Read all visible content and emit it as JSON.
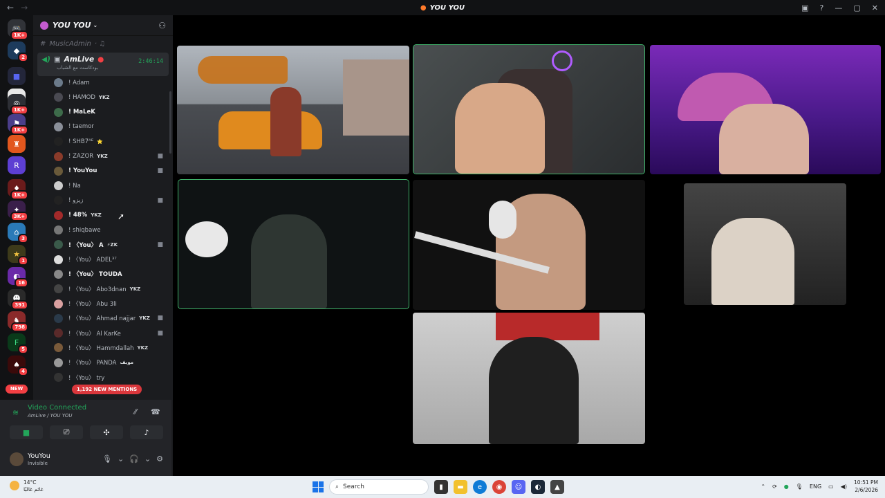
{
  "window": {
    "title": "YOU YOU"
  },
  "rail": {
    "servers": [
      {
        "badge": "1K+"
      },
      {
        "badge": "2"
      },
      {
        "badge": ""
      },
      {
        "badge": ""
      },
      {
        "badge": "1K+"
      },
      {
        "badge": "1K+"
      },
      {
        "badge": ""
      },
      {
        "badge": ""
      },
      {
        "badge": "1K+"
      },
      {
        "badge": "3K+"
      },
      {
        "badge": "3"
      },
      {
        "badge": "1"
      },
      {
        "badge": "16"
      },
      {
        "badge": "391"
      },
      {
        "badge": "798"
      },
      {
        "badge": "5"
      },
      {
        "badge": "4"
      }
    ],
    "new_label": "NEW"
  },
  "sidebar": {
    "guild_name": "YOU YOU",
    "prev_channel": "MusicAdmin",
    "voice_channel": {
      "name": "AmLive",
      "subtitle": "بودكاست مع الشباب",
      "time": "2:46:14"
    },
    "members": [
      {
        "name": "! Adam",
        "tag": "",
        "color": "#6b7a8a",
        "cam": false
      },
      {
        "name": "! HAMOD",
        "tag": "YKZ",
        "color": "#4a4a52",
        "cam": false
      },
      {
        "name": "! MaLeK",
        "tag": "",
        "color": "#3d6b4a",
        "cam": false,
        "bold": true
      },
      {
        "name": "! taemor",
        "tag": "",
        "color": "#8a8f99",
        "cam": false
      },
      {
        "name": "! SHB7ᴬᴱ",
        "tag": "⭐",
        "color": "#222",
        "cam": false
      },
      {
        "name": "! ZAZOR",
        "tag": "YKZ",
        "color": "#8a3b2a",
        "cam": true
      },
      {
        "name": "! YouYou",
        "tag": "",
        "color": "#6a5a3a",
        "cam": true,
        "bold": true
      },
      {
        "name": "! Na",
        "tag": "",
        "color": "#ccc",
        "cam": false
      },
      {
        "name": "! زيزو",
        "tag": "",
        "color": "#222",
        "cam": true
      },
      {
        "name": "! 48%",
        "tag": "YKZ",
        "color": "#a32a2a",
        "cam": false,
        "bold": true
      },
      {
        "name": "! shiqbawe",
        "tag": "",
        "color": "#777",
        "cam": false
      },
      {
        "name": "! 〈You〉 A",
        "tag": "⚡ZK",
        "color": "#3a5a4a",
        "cam": true,
        "bold": true
      },
      {
        "name": "! 〈You〉 ADEL³⁷",
        "tag": "",
        "color": "#ddd",
        "cam": false
      },
      {
        "name": "! 〈You〉 TOUDA",
        "tag": "",
        "color": "#888",
        "cam": false,
        "bold": true
      },
      {
        "name": "! 〈You〉 Abo3dnan",
        "tag": "YKZ",
        "color": "#444",
        "cam": false
      },
      {
        "name": "! 〈You〉 Abu 3li",
        "tag": "",
        "color": "#d9a0a0",
        "cam": false
      },
      {
        "name": "! 〈You〉 Ahmad najjar",
        "tag": "YKZ",
        "color": "#2a3a4a",
        "cam": true
      },
      {
        "name": "! 〈You〉 Al KarKe",
        "tag": "",
        "color": "#5a2a2a",
        "cam": true
      },
      {
        "name": "! 〈You〉 Hammdallah",
        "tag": "YKZ",
        "color": "#7a5a3a",
        "cam": false
      },
      {
        "name": "! 〈You〉 PANDA",
        "tag": "مويف",
        "color": "#999",
        "cam": false
      },
      {
        "name": "! 〈You〉 try",
        "tag": "",
        "color": "#333",
        "cam": false
      }
    ],
    "mentions_label": "1,192 NEW MENTIONS"
  },
  "voice_panel": {
    "status": "Video Connected",
    "location": "AmLive / YOU YOU"
  },
  "user": {
    "name": "YouYou",
    "status": "Invisible"
  },
  "taskbar": {
    "temp": "14°C",
    "weather_sub": "غائم غالبًا",
    "search_placeholder": "Search",
    "lang": "ENG",
    "time": "10:51 PM",
    "date": "2/6/2026"
  }
}
